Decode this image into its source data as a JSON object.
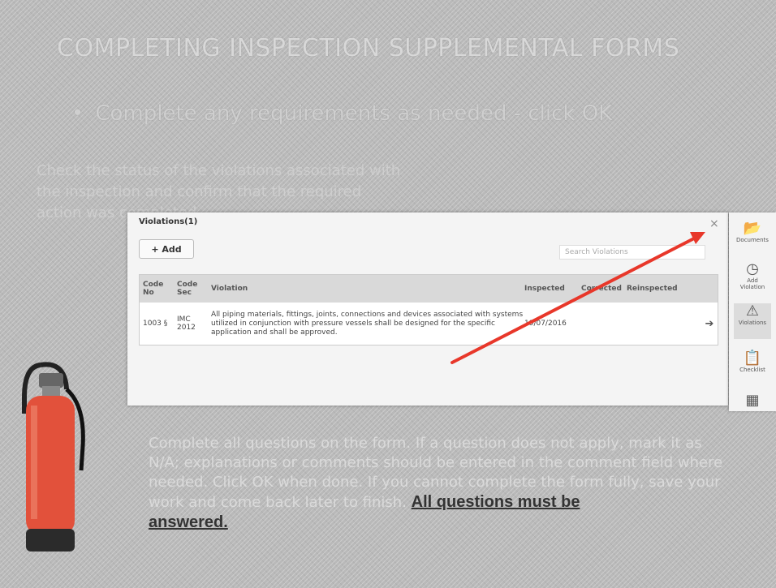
{
  "slide": {
    "title": "COMPLETING INSPECTION SUPPLEMENTAL FORMS",
    "bullet_1": "Complete any requirements as needed - click OK",
    "side_text": "Check the status of the violations associated with the inspection and confirm that the required action was completed.",
    "note_text": "Complete all questions on the form. If a question does not apply, mark it as N/A; explanations or comments should be entered in the comment field where needed. Click OK when done. If you cannot complete the form fully, save your work and come back later to finish.",
    "note_strong_1": "All questions must be",
    "note_strong_2": "answered."
  },
  "screenshot": {
    "header": "Violations(1)",
    "add_label": "+ Add",
    "search_placeholder": "Search Violations",
    "close_glyph": "×",
    "columns": [
      "Code No",
      "Code Sec",
      "Violation",
      "Inspected",
      "Corrected",
      "Reinspected"
    ],
    "row": {
      "id": "1003 §",
      "code": "IMC 2012",
      "violation": "All piping materials, fittings, joints, connections and devices associated with systems utilized in conjunction with pressure vessels shall be designed for the specific application and shall be approved.",
      "inspected": "19/07/2016",
      "corrected": "",
      "reinspected": "",
      "arrow": "➔"
    }
  },
  "right_bar": {
    "items": [
      {
        "icon": "folder-icon",
        "glyph": "📂",
        "label": "Documents"
      },
      {
        "icon": "clock-icon",
        "glyph": "◷",
        "label": "Add Violation"
      },
      {
        "icon": "warning-icon",
        "glyph": "⚠",
        "label": "Violations"
      },
      {
        "icon": "clipboard-icon",
        "glyph": "📋",
        "label": "Checklist"
      },
      {
        "icon": "grid-icon",
        "glyph": "▦",
        "label": ""
      }
    ]
  },
  "colors": {
    "arrow": "#e8372a",
    "extinguisher_body": "#e2513b"
  }
}
